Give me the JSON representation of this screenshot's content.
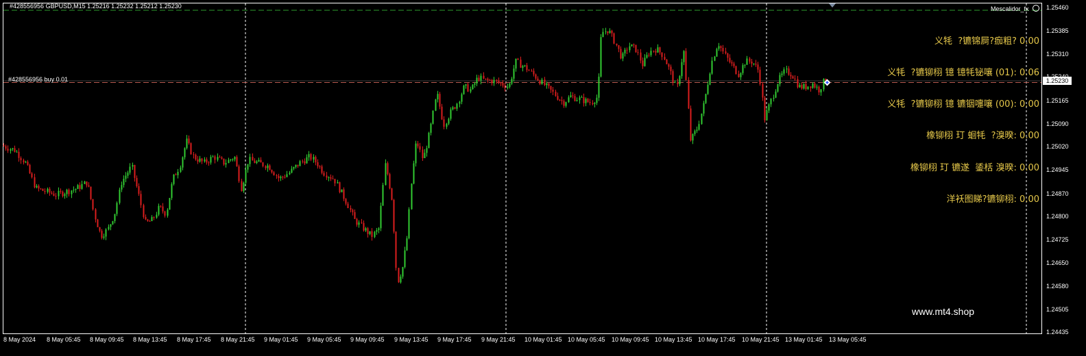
{
  "header": {
    "order_id_text": "#428556956",
    "symbol_info": "GBPUSD,M15  1.25216 1.25232 1.25212 1.25230",
    "ea_name": "Mescalidor_fx"
  },
  "order_line": {
    "label": "#428556956 buy 0.01",
    "price": 1.2523
  },
  "info_panel": {
    "rows": [
      "义牦  ?镳锦屙?痂粗? 0.00",
      "义牦  ?镳铆栩 镱 镱牦铋嚷 (01): 0.06",
      "义牦  ?镳铆栩 镱 镳铟嚏嚷 (00): 0.00",
      "橡铆栩 玎 蛔牦  ?溴暌: 0.00",
      "橡铆栩 玎 镳遂  鋈栝 溴暌: 0.00",
      "洋袄图睇?镳铆栩: 0.00"
    ]
  },
  "watermark": "www.mt4.shop",
  "price_axis": {
    "labels": [
      "1.25460",
      "1.25385",
      "1.25310",
      "1.25240",
      "1.25165",
      "1.25090",
      "1.25020",
      "1.24945",
      "1.24870",
      "1.24800",
      "1.24725",
      "1.24650",
      "1.24580",
      "1.24505",
      "1.24435"
    ]
  },
  "current_price": "1.25230",
  "time_axis": {
    "labels": [
      "8 May 2024",
      "8 May 05:45",
      "8 May 09:45",
      "8 May 13:45",
      "8 May 17:45",
      "8 May 21:45",
      "9 May 01:45",
      "9 May 05:45",
      "9 May 09:45",
      "9 May 13:45",
      "9 May 17:45",
      "9 May 21:45",
      "10 May 01:45",
      "10 May 05:45",
      "10 May 09:45",
      "10 May 13:45",
      "10 May 17:45",
      "10 May 21:45",
      "13 May 01:45",
      "13 May 05:45"
    ]
  },
  "colors": {
    "background": "#000000",
    "bull": "#32CD32",
    "bear": "#DC1E1E",
    "grid": "#FFFFFF",
    "info_text": "#E6C84A",
    "order_line": "#B85A50",
    "top_line": "#2E9B2E"
  },
  "chart_data": {
    "type": "candlestick",
    "symbol": "GBPUSD",
    "timeframe": "M15",
    "ylim": [
      1.24435,
      1.2546
    ],
    "current": {
      "open": 1.25216,
      "high": 1.25232,
      "low": 1.25212,
      "close": 1.2523
    },
    "path": [
      [
        0,
        1.2503
      ],
      [
        12,
        1.2502
      ],
      [
        25,
        1.2501
      ],
      [
        40,
        1.2497
      ],
      [
        55,
        1.2489
      ],
      [
        70,
        1.2488
      ],
      [
        85,
        1.2487
      ],
      [
        100,
        1.2488
      ],
      [
        115,
        1.2489
      ],
      [
        130,
        1.2491
      ],
      [
        140,
        1.2481
      ],
      [
        150,
        1.2474
      ],
      [
        160,
        1.2476
      ],
      [
        170,
        1.2481
      ],
      [
        180,
        1.2491
      ],
      [
        195,
        1.2496
      ],
      [
        205,
        1.2487
      ],
      [
        215,
        1.2478
      ],
      [
        225,
        1.2479
      ],
      [
        235,
        1.2483
      ],
      [
        245,
        1.2481
      ],
      [
        255,
        1.2492
      ],
      [
        265,
        1.2496
      ],
      [
        275,
        1.2504
      ],
      [
        285,
        1.2499
      ],
      [
        300,
        1.2497
      ],
      [
        315,
        1.2499
      ],
      [
        330,
        1.2497
      ],
      [
        345,
        1.2499
      ],
      [
        355,
        1.2489
      ],
      [
        365,
        1.2498
      ],
      [
        380,
        1.2497
      ],
      [
        395,
        1.2496
      ],
      [
        410,
        1.2492
      ],
      [
        425,
        1.2494
      ],
      [
        440,
        1.2497
      ],
      [
        455,
        1.2499
      ],
      [
        465,
        1.2497
      ],
      [
        475,
        1.2494
      ],
      [
        490,
        1.2492
      ],
      [
        500,
        1.2488
      ],
      [
        510,
        1.2484
      ],
      [
        520,
        1.2479
      ],
      [
        530,
        1.2477
      ],
      [
        545,
        1.2474
      ],
      [
        555,
        1.2476
      ],
      [
        565,
        1.2497
      ],
      [
        575,
        1.2485
      ],
      [
        582,
        1.2459
      ],
      [
        590,
        1.2464
      ],
      [
        597,
        1.2474
      ],
      [
        603,
        1.2491
      ],
      [
        610,
        1.2504
      ],
      [
        620,
        1.2498
      ],
      [
        630,
        1.2507
      ],
      [
        640,
        1.2519
      ],
      [
        650,
        1.2509
      ],
      [
        660,
        1.2513
      ],
      [
        670,
        1.2516
      ],
      [
        680,
        1.2521
      ],
      [
        690,
        1.252
      ],
      [
        700,
        1.2524
      ],
      [
        710,
        1.2523
      ],
      [
        720,
        1.2523
      ],
      [
        735,
        1.2522
      ],
      [
        745,
        1.2521
      ],
      [
        755,
        1.2529
      ],
      [
        770,
        1.2527
      ],
      [
        785,
        1.2524
      ],
      [
        800,
        1.2521
      ],
      [
        815,
        1.2518
      ],
      [
        825,
        1.2516
      ],
      [
        835,
        1.2518
      ],
      [
        850,
        1.2517
      ],
      [
        865,
        1.2516
      ],
      [
        875,
        1.2518
      ],
      [
        880,
        1.2538
      ],
      [
        890,
        1.2539
      ],
      [
        900,
        1.2535
      ],
      [
        910,
        1.253
      ],
      [
        920,
        1.2534
      ],
      [
        930,
        1.2533
      ],
      [
        940,
        1.2528
      ],
      [
        950,
        1.2532
      ],
      [
        960,
        1.2533
      ],
      [
        970,
        1.2531
      ],
      [
        980,
        1.2526
      ],
      [
        990,
        1.252
      ],
      [
        1000,
        1.2533
      ],
      [
        1010,
        1.2504
      ],
      [
        1020,
        1.2508
      ],
      [
        1030,
        1.2516
      ],
      [
        1040,
        1.2528
      ],
      [
        1050,
        1.2535
      ],
      [
        1060,
        1.2531
      ],
      [
        1070,
        1.2528
      ],
      [
        1080,
        1.2525
      ],
      [
        1090,
        1.2529
      ],
      [
        1100,
        1.2529
      ],
      [
        1110,
        1.2526
      ],
      [
        1118,
        1.2511
      ],
      [
        1128,
        1.2517
      ],
      [
        1138,
        1.2523
      ],
      [
        1148,
        1.2526
      ],
      [
        1158,
        1.2525
      ],
      [
        1168,
        1.2521
      ],
      [
        1178,
        1.2521
      ],
      [
        1188,
        1.2522
      ],
      [
        1198,
        1.252
      ],
      [
        1205,
        1.2523
      ]
    ]
  }
}
